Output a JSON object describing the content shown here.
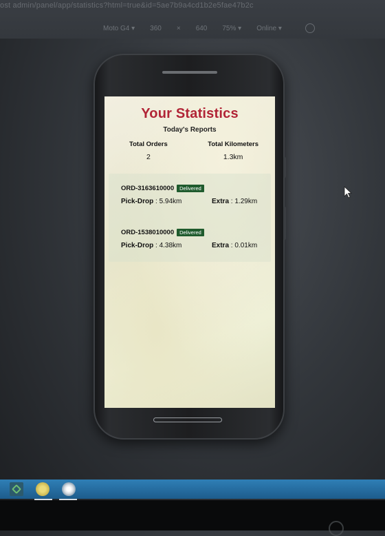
{
  "browser": {
    "url_fragment": "ost",
    "url_blurred": "admin/panel/app/statistics?html=true&id=5ae7b9a4cd1b2e5fae47b2c",
    "device_toolbar": {
      "device": "Moto G4 ▾",
      "width": "360",
      "height": "640",
      "zoom": "75% ▾",
      "throttle": "Online ▾"
    }
  },
  "app": {
    "title": "Your Statistics",
    "subtitle": "Today's Reports",
    "totals": {
      "orders_label": "Total Orders",
      "orders_value": "2",
      "km_label": "Total Kilometers",
      "km_value": "1.3km"
    },
    "orders": [
      {
        "id": "ORD-3163610000",
        "status": "Delivered",
        "pick_drop_label": "Pick-Drop",
        "pick_drop_value": " : 5.94km",
        "extra_label": "Extra",
        "extra_value": " : 1.29km"
      },
      {
        "id": "ORD-1538010000",
        "status": "Delivered",
        "pick_drop_label": "Pick-Drop",
        "pick_drop_value": " : 4.38km",
        "extra_label": "Extra",
        "extra_value": " : 0.01km"
      }
    ]
  },
  "colors": {
    "title": "#b12436",
    "badge": "#1f5b2d",
    "taskbar": "#2f7fb6"
  },
  "icons": {
    "rotate": "rotate-icon",
    "cursor": "mouse-cursor-icon",
    "taskbar_apps": [
      "app-launcher-icon",
      "chrome-icon",
      "app-icon"
    ]
  }
}
